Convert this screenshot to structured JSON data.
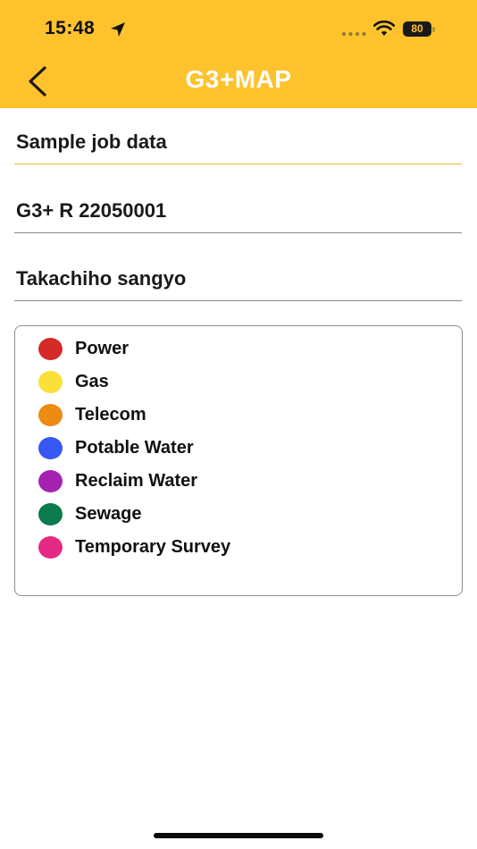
{
  "status_bar": {
    "time": "15:48",
    "battery_level": "80",
    "battery_fraction": 0.8,
    "icons": [
      "location-arrow-icon",
      "signal-dots-icon",
      "wifi-icon",
      "battery-icon"
    ]
  },
  "nav": {
    "title": "G3+MAP",
    "back_icon": "chevron-left-icon",
    "background_color": "#FEC22D",
    "title_color": "#FFFFFF"
  },
  "fields": {
    "job_name": "Sample job data",
    "job_id": "G3+ R 22050001",
    "company": "Takachiho sangyo"
  },
  "legend": {
    "items": [
      {
        "label": "Power",
        "color": "#D42A28"
      },
      {
        "label": "Gas",
        "color": "#FCE03A"
      },
      {
        "label": "Telecom",
        "color": "#EC8A12"
      },
      {
        "label": "Potable Water",
        "color": "#3658F4"
      },
      {
        "label": "Reclaim Water",
        "color": "#A422B2"
      },
      {
        "label": "Sewage",
        "color": "#0B7A4C"
      },
      {
        "label": "Temporary Survey",
        "color": "#E42A83"
      }
    ]
  }
}
